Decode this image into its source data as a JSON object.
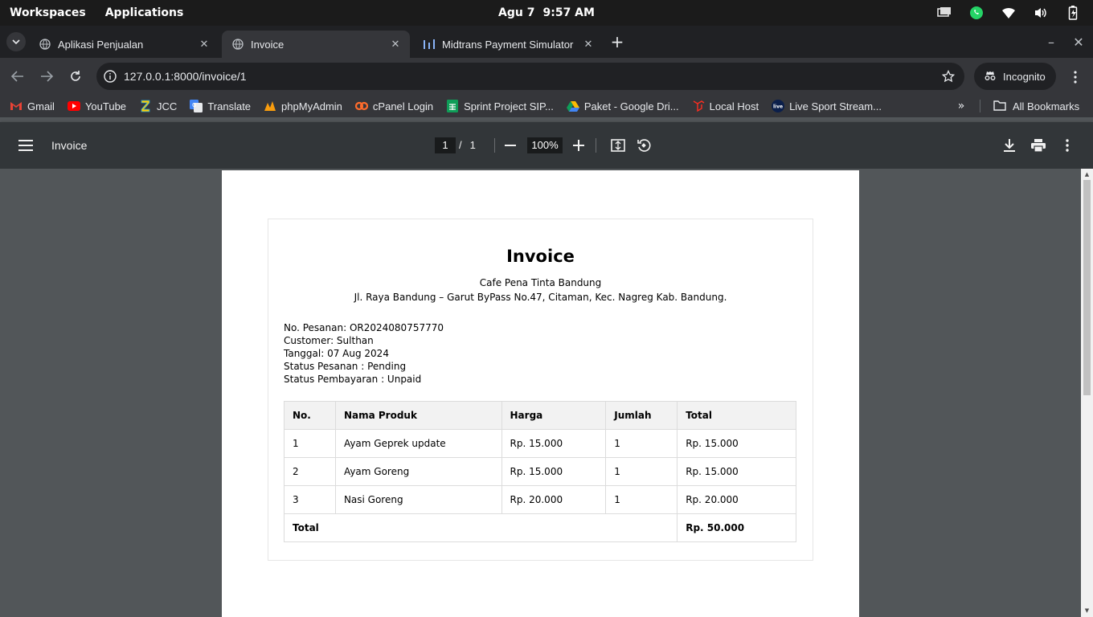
{
  "system": {
    "workspaces": "Workspaces",
    "applications": "Applications",
    "date": "Agu 7",
    "time": "9:57 AM"
  },
  "tabs": [
    {
      "title": "Aplikasi Penjualan",
      "icon": "globe-icon",
      "active": false
    },
    {
      "title": "Invoice",
      "icon": "globe-icon",
      "active": true
    },
    {
      "title": "Midtrans Payment Simulator",
      "icon": "midtrans-icon",
      "active": false
    }
  ],
  "toolbar": {
    "url": "127.0.0.1:8000/invoice/1",
    "incognito_label": "Incognito"
  },
  "bookmarks": [
    {
      "label": "Gmail",
      "icon": "gmail-icon"
    },
    {
      "label": "YouTube",
      "icon": "youtube-icon"
    },
    {
      "label": "JCC",
      "icon": "jcc-icon"
    },
    {
      "label": "Translate",
      "icon": "translate-icon"
    },
    {
      "label": "phpMyAdmin",
      "icon": "phpmyadmin-icon"
    },
    {
      "label": "cPanel Login",
      "icon": "cpanel-icon"
    },
    {
      "label": "Sprint Project SIP...",
      "icon": "sheets-icon"
    },
    {
      "label": "Paket - Google Dri...",
      "icon": "drive-icon"
    },
    {
      "label": "Local Host",
      "icon": "laravel-icon"
    },
    {
      "label": "Live Sport Stream...",
      "icon": "live-icon"
    }
  ],
  "all_bookmarks": "All Bookmarks",
  "pdf": {
    "title": "Invoice",
    "current_page": "1",
    "page_sep": "/",
    "total_pages": "1",
    "zoom": "100%"
  },
  "invoice": {
    "title": "Invoice",
    "company": "Cafe Pena Tinta Bandung",
    "address": "Jl. Raya Bandung – Garut ByPass No.47, Citaman, Kec. Nagreg Kab. Bandung.",
    "meta": [
      "No. Pesanan: OR2024080757770",
      "Customer: Sulthan",
      "Tanggal: 07 Aug 2024",
      "Status Pesanan : Pending",
      "Status Pembayaran : Unpaid"
    ],
    "headers": [
      "No.",
      "Nama Produk",
      "Harga",
      "Jumlah",
      "Total"
    ],
    "rows": [
      [
        "1",
        "Ayam Geprek update",
        "Rp. 15.000",
        "1",
        "Rp. 15.000"
      ],
      [
        "2",
        "Ayam Goreng",
        "Rp. 15.000",
        "1",
        "Rp. 15.000"
      ],
      [
        "3",
        "Nasi Goreng",
        "Rp. 20.000",
        "1",
        "Rp. 20.000"
      ]
    ],
    "total_label": "Total",
    "total_value": "Rp. 50.000"
  },
  "colors": {
    "topbar": "#1b1b1b",
    "tabstrip": "#202124",
    "toolbar": "#35363a",
    "pdfbar": "#323639",
    "viewer_bg": "#525659"
  }
}
